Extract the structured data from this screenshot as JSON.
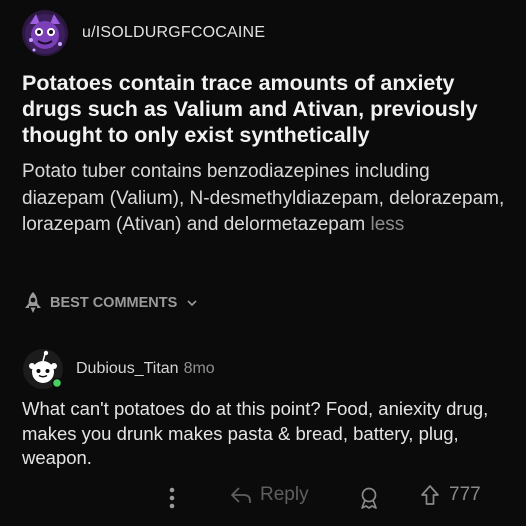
{
  "post": {
    "author": "u/ISOLDURGFCOCAINE",
    "title": "Potatoes contain trace amounts of anxiety drugs such as Valium and Ativan, previously thought to only exist synthetically",
    "body": "Potato tuber contains benzodiazepines including diazepam (Valium), N-desmethyldiazepam, delorazepam, lorazepam (Ativan) and delormetazepam",
    "more_label": "less"
  },
  "comments_sort": {
    "label": "BEST COMMENTS",
    "icon": "rocket-icon"
  },
  "comment": {
    "author": "Dubious_Titan",
    "age": "8mo",
    "body": "What can't potatoes do at this point? Food, aniexity drug, makes you drunk makes pasta & bread, battery, plug, weapon.",
    "actions": {
      "reply_label": "Reply",
      "score": "777"
    }
  },
  "colors": {
    "background": "#0b0b0b",
    "online_dot": "#46d160",
    "avatar_purple": "#7b3fb8"
  }
}
